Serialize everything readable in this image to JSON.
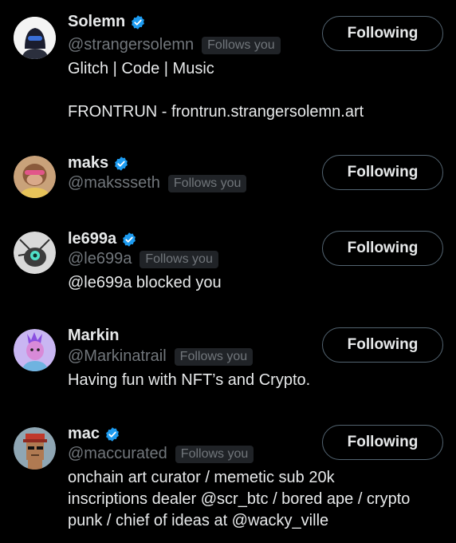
{
  "users": [
    {
      "name": "Solemn",
      "verified": true,
      "handle": "@strangersolemn",
      "follows_badge": "Follows you",
      "bio": "Glitch | Code | Music\n\nFRONTRUN - frontrun.strangersolemn.art",
      "button_label": "Following",
      "avatar_icon": "helmet-avatar"
    },
    {
      "name": "maks",
      "verified": true,
      "handle": "@makssseth",
      "follows_badge": "Follows you",
      "bio": "",
      "button_label": "Following",
      "avatar_icon": "ape-avatar"
    },
    {
      "name": "le699a",
      "verified": true,
      "handle": "@le699a",
      "follows_badge": "Follows you",
      "bio": "@le699a blocked you",
      "button_label": "Following",
      "avatar_icon": "robot-avatar"
    },
    {
      "name": "Markin",
      "verified": false,
      "handle": "@Markinatrail",
      "follows_badge": "Follows you",
      "bio": "Having fun with NFT’s and Crypto.",
      "button_label": "Following",
      "avatar_icon": "purple-character-avatar"
    },
    {
      "name": "mac",
      "verified": true,
      "handle": "@maccurated",
      "follows_badge": "Follows you",
      "bio": "onchain art curator / memetic sub 20k\ninscriptions dealer @scr_btc / bored ape / crypto\npunk / chief of ideas at @wacky_ville",
      "button_label": "Following",
      "avatar_icon": "cryptopunk-avatar"
    }
  ],
  "colors": {
    "background": "#000000",
    "primary_text": "#e7e9ea",
    "secondary_text": "#71767b",
    "badge_bg": "#202327",
    "verified_blue": "#1d9bf0",
    "button_border": "#536471"
  }
}
